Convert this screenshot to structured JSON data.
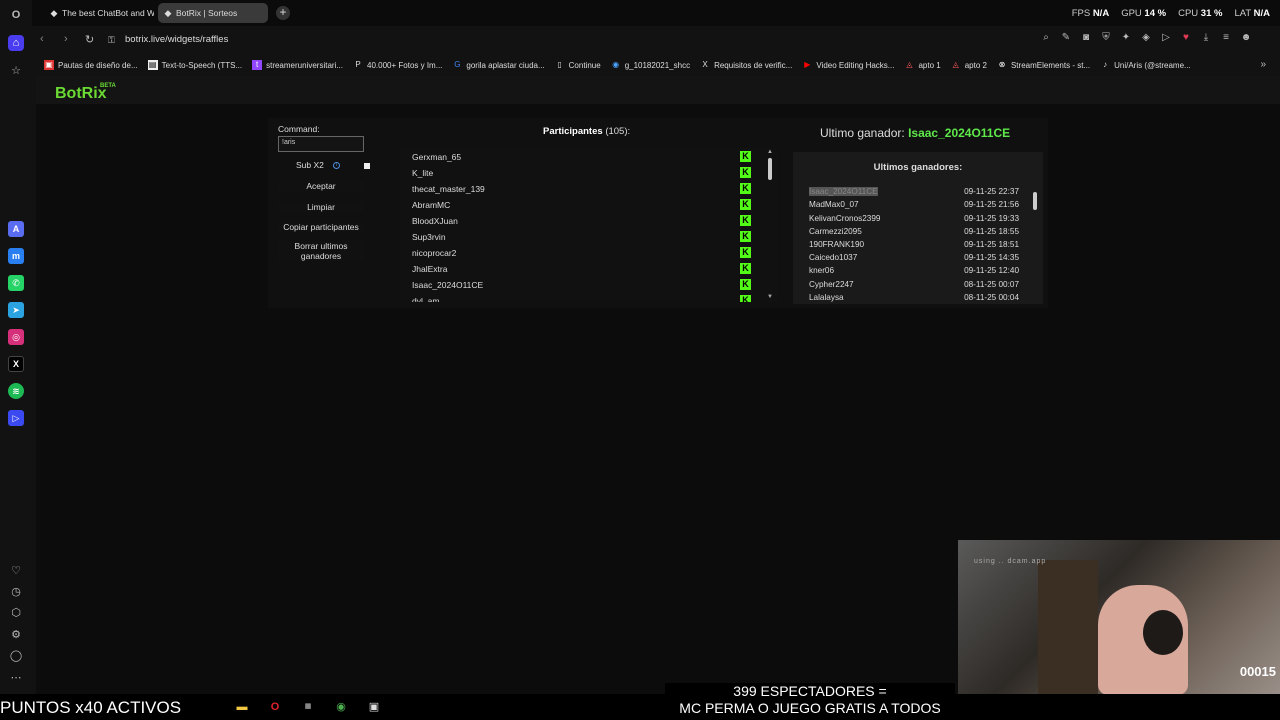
{
  "browser": {
    "tabs": [
      {
        "label": "The best ChatBot and Wic"
      },
      {
        "label": "BotRix | Sorteos"
      }
    ],
    "stats": {
      "fps_label": "FPS",
      "fps": "N/A",
      "gpu_label": "GPU",
      "gpu": "14 %",
      "cpu_label": "CPU",
      "cpu": "31 %",
      "lat_label": "LAT",
      "lat": "N/A"
    },
    "url": "botrix.live/widgets/raffles",
    "bookmarks": [
      "Pautas de diseño de...",
      "Text-to-Speech (TTS...",
      "streameruniversitari...",
      "40.000+ Fotos y Im...",
      "gorila aplastar ciuda...",
      "Continue",
      "g_10182021_shcc",
      "Requisitos de verific...",
      "Video Editing Hacks...",
      "apto 1",
      "apto 2",
      "StreamElements - st...",
      "Uni/Aris (@streame..."
    ]
  },
  "site": {
    "logo": "BotRix",
    "beta": "BETA"
  },
  "controls": {
    "command_label": "Command:",
    "command_value": "!aris",
    "sub_label": "Sub X2",
    "aceptar": "Aceptar",
    "limpiar": "Limpiar",
    "copiar": "Copiar participantes",
    "borrar": "Borrar ultimos ganadores"
  },
  "participants": {
    "title": "Participantes",
    "count": "(105):",
    "names": [
      "Gerxman_65",
      "K_lite",
      "thecat_master_139",
      "AbramMC",
      "BloodXJuan",
      "Sup3rvin",
      "nicoprocar2",
      "JhalExtra",
      "Isaac_2024O11CE",
      "dyl_am"
    ]
  },
  "winner": {
    "label": "Ultimo ganador:",
    "name": "Isaac_2024O11CE",
    "list_title": "Ultimos ganadores:",
    "rows": [
      {
        "name": "Isaac_2024O11CE",
        "date": "09-11-25 22:37"
      },
      {
        "name": "MadMax0_07",
        "date": "09-11-25 21:56"
      },
      {
        "name": "KelivanCronos2399",
        "date": "09-11-25 19:33"
      },
      {
        "name": "Carmezzi2095",
        "date": "09-11-25 18:55"
      },
      {
        "name": "190FRANK190",
        "date": "09-11-25 18:51"
      },
      {
        "name": "Caicedo1037",
        "date": "09-11-25 14:35"
      },
      {
        "name": "kner06",
        "date": "09-11-25 12:40"
      },
      {
        "name": "Cypher2247",
        "date": "08-11-25 00:07"
      },
      {
        "name": "Lalalaysa",
        "date": "08-11-25 00:04"
      }
    ]
  },
  "overlay": {
    "puntos": "PUNTOS x40 ACTIVOS",
    "esp_line1": "399 ESPECTADORES =",
    "esp_line2": "MC PERMA O JUEGO GRATIS A TODOS",
    "cam_text": "using .. dcam.app",
    "cam_counter": "00015"
  }
}
